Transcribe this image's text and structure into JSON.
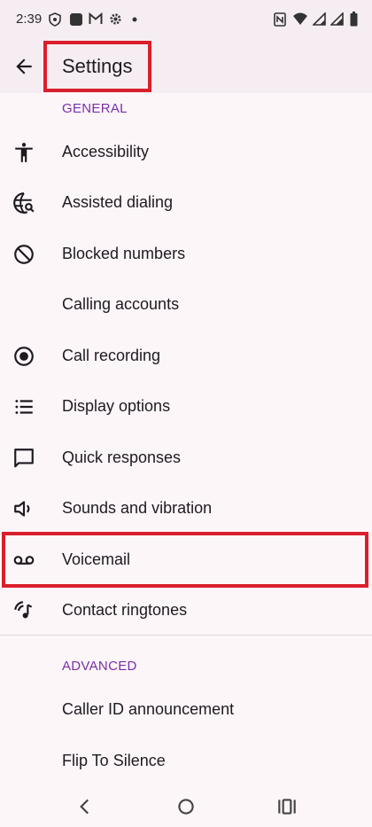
{
  "status_bar": {
    "time": "2:39",
    "left_icons": [
      "shield-icon",
      "app-square-icon",
      "gmail-icon",
      "settings-gear-icon",
      "dot-icon"
    ],
    "right_icons": [
      "nfc-icon",
      "wifi-icon",
      "signal-icon",
      "signal-icon",
      "battery-icon"
    ]
  },
  "app_bar": {
    "back_icon": "arrow-back-icon",
    "title": "Settings"
  },
  "sections": {
    "general": "GENERAL",
    "advanced": "ADVANCED"
  },
  "general_items": [
    {
      "label": "Accessibility",
      "icon": "accessibility-icon"
    },
    {
      "label": "Assisted dialing",
      "icon": "assisted-dialing-icon"
    },
    {
      "label": "Blocked numbers",
      "icon": "block-icon"
    },
    {
      "label": "Calling accounts",
      "icon": ""
    },
    {
      "label": "Call recording",
      "icon": "record-icon"
    },
    {
      "label": "Display options",
      "icon": "list-icon"
    },
    {
      "label": "Quick responses",
      "icon": "message-icon"
    },
    {
      "label": "Sounds and vibration",
      "icon": "volume-icon"
    },
    {
      "label": "Voicemail",
      "icon": "voicemail-icon"
    },
    {
      "label": "Contact ringtones",
      "icon": "ringtone-icon"
    }
  ],
  "advanced_items": [
    {
      "label": "Caller ID announcement"
    },
    {
      "label": "Flip To Silence"
    }
  ],
  "colors": {
    "accent_section": "#7b2fa8",
    "highlight": "#d91f2b",
    "background": "#fdf6f9",
    "bar": "#f6edf2"
  }
}
